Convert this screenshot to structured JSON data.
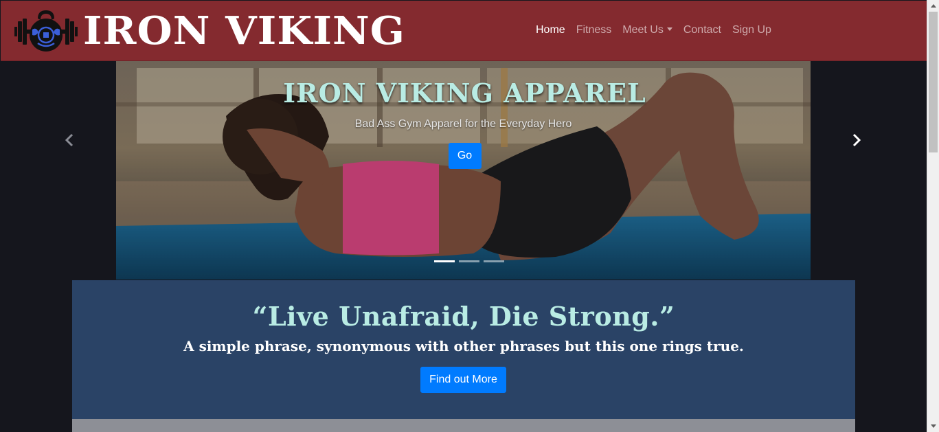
{
  "brand": {
    "name": "IRON VIKING",
    "logo_icon": "kettlebell-barbell-logo-icon"
  },
  "nav": {
    "items": [
      {
        "label": "Home",
        "active": true
      },
      {
        "label": "Fitness",
        "active": false
      },
      {
        "label": "Meet Us",
        "active": false,
        "dropdown": true
      },
      {
        "label": "Contact",
        "active": false
      },
      {
        "label": "Sign Up",
        "active": false
      }
    ]
  },
  "carousel": {
    "title": "IRON VIKING APPAREL",
    "subtitle": "Bad Ass Gym Apparel for the Everyday Hero",
    "button_label": "Go",
    "slide_count": 3,
    "active_slide": 1,
    "prev_icon": "chevron-left-icon",
    "next_icon": "chevron-right-icon"
  },
  "quote": {
    "title": "“Live Unafraid, Die Strong.”",
    "subtitle": "A simple phrase, synonymous with other phrases but this one rings true.",
    "button_label": "Find out More"
  },
  "colors": {
    "navbar": "#842a2f",
    "page_bg": "#15161d",
    "quote_bg": "#2a4366",
    "accent_text": "#b9ece4",
    "button": "#007bff"
  }
}
